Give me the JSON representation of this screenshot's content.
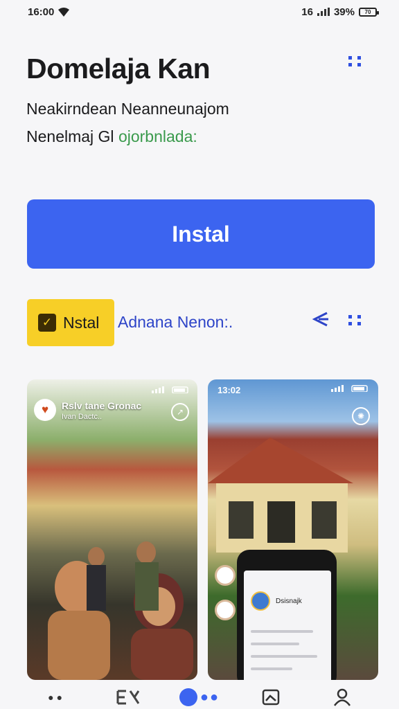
{
  "status_bar": {
    "time": "16:00",
    "signal": "16",
    "battery": "39%",
    "battery_icon": "70"
  },
  "header": {
    "title": "Domelaja Kan",
    "line1": "Neakirndean Neanneunajom",
    "line2_prefix": "Nenelmaj Gl",
    "line2_highlight": "ojorbnlada:"
  },
  "install": {
    "label": "Instal"
  },
  "developer": {
    "chip_label": "Nstal",
    "chip_icon": "✓",
    "name": "Adnana Nenon:."
  },
  "screenshots": {
    "shot1": {
      "badge": "♥",
      "title": "Rslv tane Gronac",
      "subtitle": "Ivan Dactc.."
    },
    "shot2": {
      "time": "13:02",
      "phone_name": "Dsisnajk"
    }
  },
  "colors": {
    "accent": "#3c64f0",
    "chip": "#f7cf27",
    "link": "#2d44c8"
  },
  "icons": [
    "wifi-icon",
    "menu-dots-icon",
    "share-icon",
    "home-icon",
    "list-icon",
    "image-icon",
    "profile-icon"
  ]
}
